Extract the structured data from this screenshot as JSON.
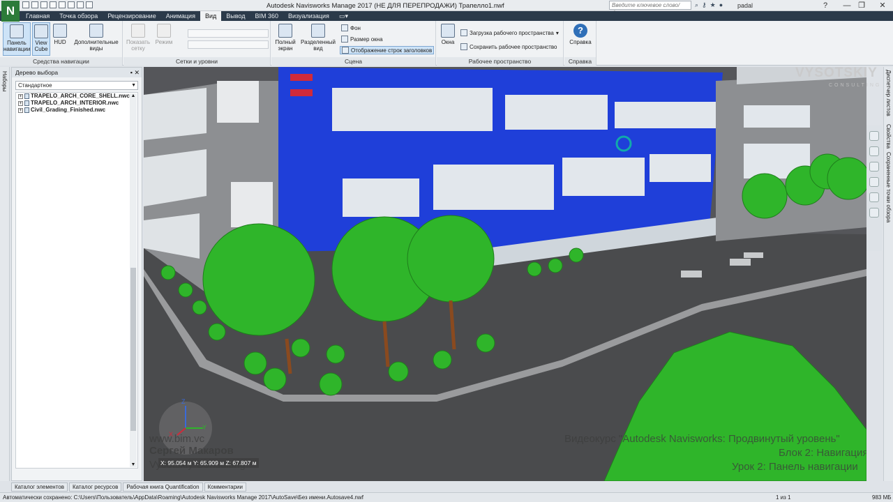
{
  "app": {
    "logo_letter": "N",
    "window_title": "Autodesk Navisworks Manage 2017 (НЕ ДЛЯ ПЕРЕПРОДАЖИ)   Трапелло1.nwf",
    "search_placeholder": "Введите ключевое слово/фразу",
    "user": "padal"
  },
  "tabs": [
    {
      "label": "Главная"
    },
    {
      "label": "Точка обзора"
    },
    {
      "label": "Рецензирование"
    },
    {
      "label": "Анимация"
    },
    {
      "label": "Вид"
    },
    {
      "label": "Вывод"
    },
    {
      "label": "BIM 360"
    },
    {
      "label": "Визуализация"
    }
  ],
  "active_tab": "Вид",
  "ribbon": {
    "nav_panel": {
      "title": "Средства навигации",
      "panel_nav": "Панель\nнавигации",
      "view_cube": "View\nCube",
      "hud": "HUD",
      "extra_views": "Дополнительные\nвиды"
    },
    "grid_panel": {
      "title": "Сетки и уровни",
      "show_grid": "Показать\nсетку",
      "modes": "Режим"
    },
    "scene_panel": {
      "title": "Сцена",
      "fullscreen": "Полный\nэкран",
      "split_view": "Разделенный\nвид",
      "background": "Фон",
      "window_size": "Размер окна",
      "show_headers": "Отображение строк заголовков"
    },
    "workspace_panel": {
      "title": "Рабочее пространство",
      "windows": "Окна",
      "load_workspace": "Загрузка рабочего пространства",
      "save_workspace": "Сохранить рабочее пространство"
    },
    "help_panel": {
      "title": "Справка",
      "help": "Справка"
    }
  },
  "left_dock": {
    "tab_label": "Наборы"
  },
  "selection_tree": {
    "title": "Дерево выбора",
    "dropdown_value": "Стандартное",
    "items": [
      {
        "label": "TRAPELO_ARCH_CORE_SHELL.nwc"
      },
      {
        "label": "TRAPELO_ARCH_INTERIOR.nwc"
      },
      {
        "label": "Civil_Grading_Finished.nwc"
      }
    ]
  },
  "right_dock": {
    "tabs": [
      {
        "label": "Диспетчер листов"
      },
      {
        "label": "Свойства"
      },
      {
        "label": "Сохраненные точки обзора"
      }
    ]
  },
  "viewport": {
    "coords": "X: 95.054 м  Y: 65.909 м  Z: 67.807 м",
    "axis_labels": {
      "x": "X",
      "y": "Y",
      "z": "Z"
    },
    "overlay": {
      "site": "www.bim.vc",
      "author": "Сергей Макаров",
      "company": "Vysotskiy Consulting",
      "course": "Видеокурс \"Autodesk Navisworks: Продвинутый уровень\"",
      "block": "Блок 2: Навигация",
      "lesson": "Урок 2: Панель навигации"
    },
    "watermark": "VYSOTSKIY",
    "watermark_sub": "CONSULTING"
  },
  "bottom_tabs": [
    {
      "label": "Каталог элементов"
    },
    {
      "label": "Каталог ресурсов"
    },
    {
      "label": "Рабочая книга Quantification"
    },
    {
      "label": "Комментарии"
    }
  ],
  "status": {
    "autosave": "Автоматически сохранено: C:\\Users\\Пользователь\\AppData\\Roaming\\Autodesk Navisworks Manage 2017\\AutoSave\\Без имени.Autosave4.nwf",
    "page": "1 из 1",
    "memory": "983 МБ"
  },
  "colors": {
    "facade_blue": "#1f3fd9",
    "tree_green": "#2fb52a",
    "ground": "#4a4b4d",
    "building_grey": "#8d8f92"
  }
}
